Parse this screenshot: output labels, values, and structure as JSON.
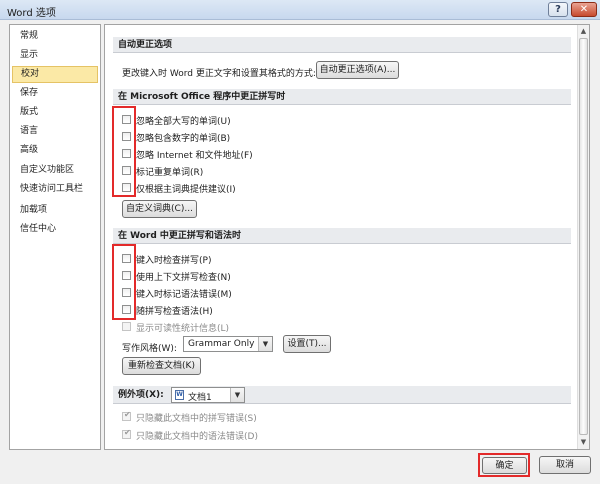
{
  "window": {
    "title": "Word 选项"
  },
  "sidebar": {
    "items": [
      {
        "label": "常规"
      },
      {
        "label": "显示"
      },
      {
        "label": "校对"
      },
      {
        "label": "保存"
      },
      {
        "label": "版式"
      },
      {
        "label": "语言"
      },
      {
        "label": "高级"
      },
      {
        "label": "自定义功能区"
      },
      {
        "label": "快速访问工具栏"
      },
      {
        "label": "加载项"
      },
      {
        "label": "信任中心"
      }
    ],
    "selected": "校对"
  },
  "autocorrect": {
    "header": "自动更正选项",
    "description": "更改键入时 Word 更正文字和设置其格式的方式:",
    "button_label": "自动更正选项(A)..."
  },
  "office_spelling": {
    "header": "在 Microsoft Office 程序中更正拼写时",
    "options": [
      {
        "label": "忽略全部大写的单词(U)",
        "checked": false
      },
      {
        "label": "忽略包含数字的单词(B)",
        "checked": false
      },
      {
        "label": "忽略 Internet 和文件地址(F)",
        "checked": false
      },
      {
        "label": "标记重复单词(R)",
        "checked": false
      },
      {
        "label": "仅根据主词典提供建议(I)",
        "checked": false
      }
    ],
    "custom_dict_button": "自定义词典(C)..."
  },
  "word_grammar": {
    "header": "在 Word 中更正拼写和语法时",
    "options": [
      {
        "label": "键入时检查拼写(P)",
        "checked": false
      },
      {
        "label": "使用上下文拼写检查(N)",
        "checked": false
      },
      {
        "label": "键入时标记语法错误(M)",
        "checked": false
      },
      {
        "label": "随拼写检查语法(H)",
        "checked": false
      }
    ],
    "readability": {
      "label": "显示可读性统计信息(L)",
      "checked": false,
      "disabled": true
    },
    "writing_style_label": "写作风格(W):",
    "writing_style_value": "Grammar Only",
    "settings_button": "设置(T)...",
    "recheck_button": "重新检查文档(K)"
  },
  "exceptions": {
    "label": "例外项(X):",
    "document_value": "文档1",
    "options": [
      {
        "label": "只隐藏此文档中的拼写错误(S)",
        "checked": true,
        "disabled": true
      },
      {
        "label": "只隐藏此文档中的语法错误(D)",
        "checked": true,
        "disabled": true
      }
    ]
  },
  "footer": {
    "ok_label": "确定",
    "cancel_label": "取消"
  },
  "colors": {
    "highlight_red": "#e32a2a",
    "selected_nav": "#fbe9a6"
  }
}
